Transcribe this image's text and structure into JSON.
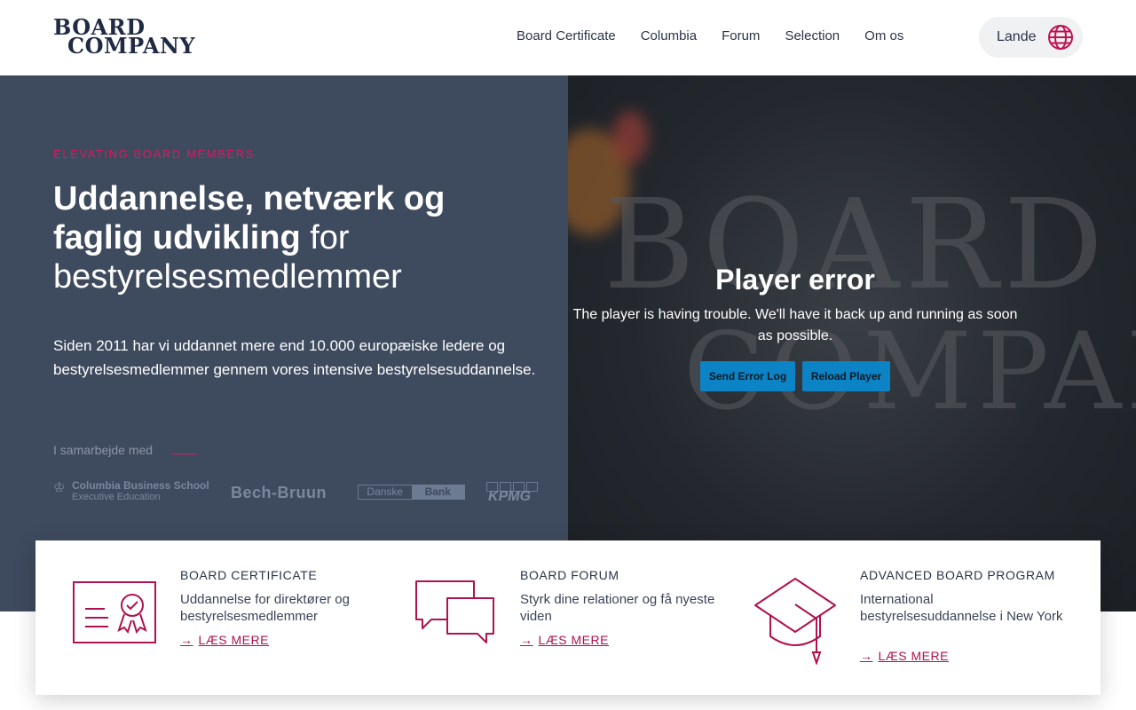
{
  "header": {
    "logo_line1": "BOARD",
    "logo_line2": "COMPANY",
    "nav": [
      "Board Certificate",
      "Columbia",
      "Forum",
      "Selection",
      "Om os"
    ],
    "lande_label": "Lande",
    "lande_icon": "globe-icon"
  },
  "hero": {
    "kicker": "ELEVATING BOARD MEMBERS",
    "headline_bold": "Uddannelse, netværk og faglig udvikling",
    "headline_rest": " for bestyrelsesmedlemmer",
    "lead": "Siden 2011 har vi uddannet mere end 10.000 europæiske ledere og bestyrelsesmedlemmer gennem vores intensive bestyrelsesuddannelse.",
    "partner_label": "I samarbejde med",
    "partners": {
      "cbs_line1": "Columbia Business School",
      "cbs_line2": "Executive Education",
      "bech": "Bech-Bruun",
      "danske_a": "Danske",
      "danske_b": "Bank",
      "kpmg": "KPMG"
    }
  },
  "video": {
    "bg_text_1": "BOARD",
    "bg_text_2": "COMPANY",
    "error_title": "Player error",
    "error_message": "The player is having trouble. We'll have it back up and running as soon as possible.",
    "send_log_label": "Send Error Log",
    "reload_label": "Reload Player"
  },
  "cards": [
    {
      "icon": "certificate-icon",
      "title": "BOARD CERTIFICATE",
      "desc": "Uddannelse for direktører og bestyrelsesmedlemmer",
      "link": "LÆS MERE"
    },
    {
      "icon": "chat-bubbles-icon",
      "title": "BOARD FORUM",
      "desc": "Styrk dine relationer og få nyeste viden",
      "link": "LÆS MERE"
    },
    {
      "icon": "graduation-cap-icon",
      "title": "ADVANCED BOARD PROGRAM",
      "desc": "International bestyrelsesuddannelse i New York",
      "link": "LÆS MERE"
    }
  ],
  "colors": {
    "accent": "#d21d63",
    "hero_bg": "#3e4a5e",
    "button_blue": "#0b83c4"
  }
}
